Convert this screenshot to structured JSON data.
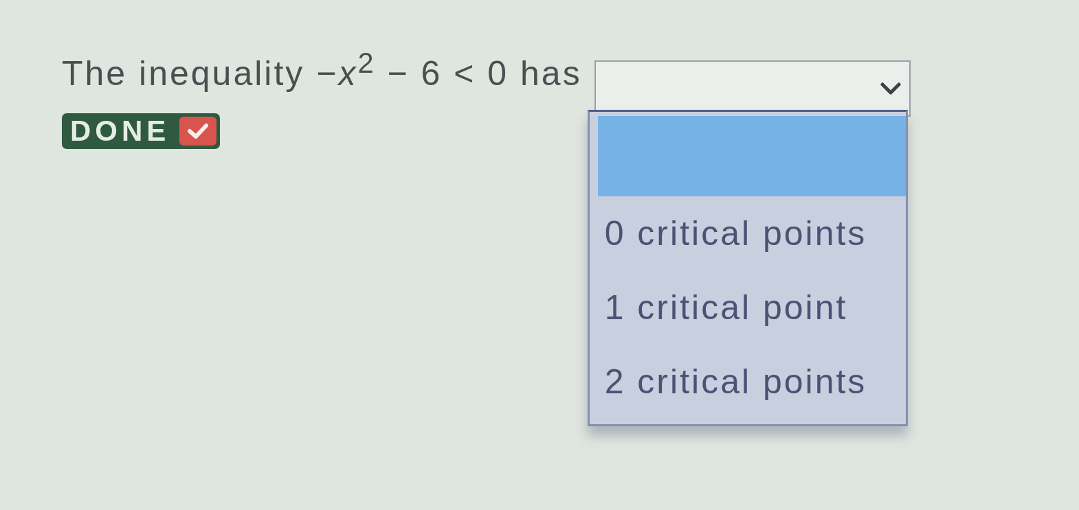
{
  "question": {
    "text": "The inequality −*x*$^{2}$ − 6 < 0 has"
  },
  "done_button": {
    "label": "DONE"
  },
  "dropdown": {
    "expanded": true,
    "options": [
      {
        "selected": true
      },
      {
        "label": "0 critical points",
        "selected": false
      },
      {
        "label": "1 critical point",
        "selected": false
      },
      {
        "label": "2 critical points",
        "selected": false
      }
    ]
  }
}
